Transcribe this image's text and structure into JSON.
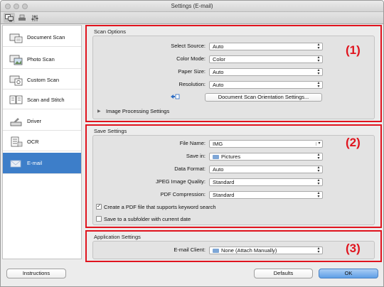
{
  "window": {
    "title": "Settings (E-mail)"
  },
  "toolbar": {
    "tabs": [
      {
        "icon": "scan-from-computer-icon"
      },
      {
        "icon": "scan-from-operation-panel-icon"
      },
      {
        "icon": "general-settings-icon"
      }
    ]
  },
  "sidebar": {
    "items": [
      {
        "label": "Document Scan",
        "icon": "document-scan-icon"
      },
      {
        "label": "Photo Scan",
        "icon": "photo-scan-icon"
      },
      {
        "label": "Custom Scan",
        "icon": "custom-scan-icon"
      },
      {
        "label": "Scan and Stitch",
        "icon": "scan-and-stitch-icon"
      },
      {
        "label": "Driver",
        "icon": "driver-icon"
      },
      {
        "label": "OCR",
        "icon": "ocr-icon"
      },
      {
        "label": "E-mail",
        "icon": "e-mail-icon",
        "selected": true
      }
    ]
  },
  "scan_options": {
    "title": "Scan Options",
    "number": "(1)",
    "select_source": {
      "label": "Select Source:",
      "value": "Auto"
    },
    "color_mode": {
      "label": "Color Mode:",
      "value": "Color"
    },
    "paper_size": {
      "label": "Paper Size:",
      "value": "Auto"
    },
    "resolution": {
      "label": "Resolution:",
      "value": "Auto"
    },
    "orientation_button": "Document Scan Orientation Settings...",
    "image_processing": "Image Processing Settings"
  },
  "save_settings": {
    "title": "Save Settings",
    "number": "(2)",
    "file_name": {
      "label": "File Name:",
      "value": "IMG"
    },
    "save_in": {
      "label": "Save in:",
      "value": "Pictures"
    },
    "data_format": {
      "label": "Data Format:",
      "value": "Auto"
    },
    "jpeg_quality": {
      "label": "JPEG Image Quality:",
      "value": "Standard"
    },
    "pdf_compression": {
      "label": "PDF Compression:",
      "value": "Standard"
    },
    "keyword_search": {
      "label": "Create a PDF file that supports keyword search",
      "checked": true
    },
    "subfolder": {
      "label": "Save to a subfolder with current date",
      "checked": false
    }
  },
  "application_settings": {
    "title": "Application Settings",
    "number": "(3)",
    "email_client": {
      "label": "E-mail Client:",
      "value": "None (Attach Manually)"
    }
  },
  "footer": {
    "instructions": "Instructions",
    "defaults": "Defaults",
    "ok": "OK"
  },
  "colors": {
    "highlight": "#e0141e",
    "selection": "#3d7ec9"
  }
}
